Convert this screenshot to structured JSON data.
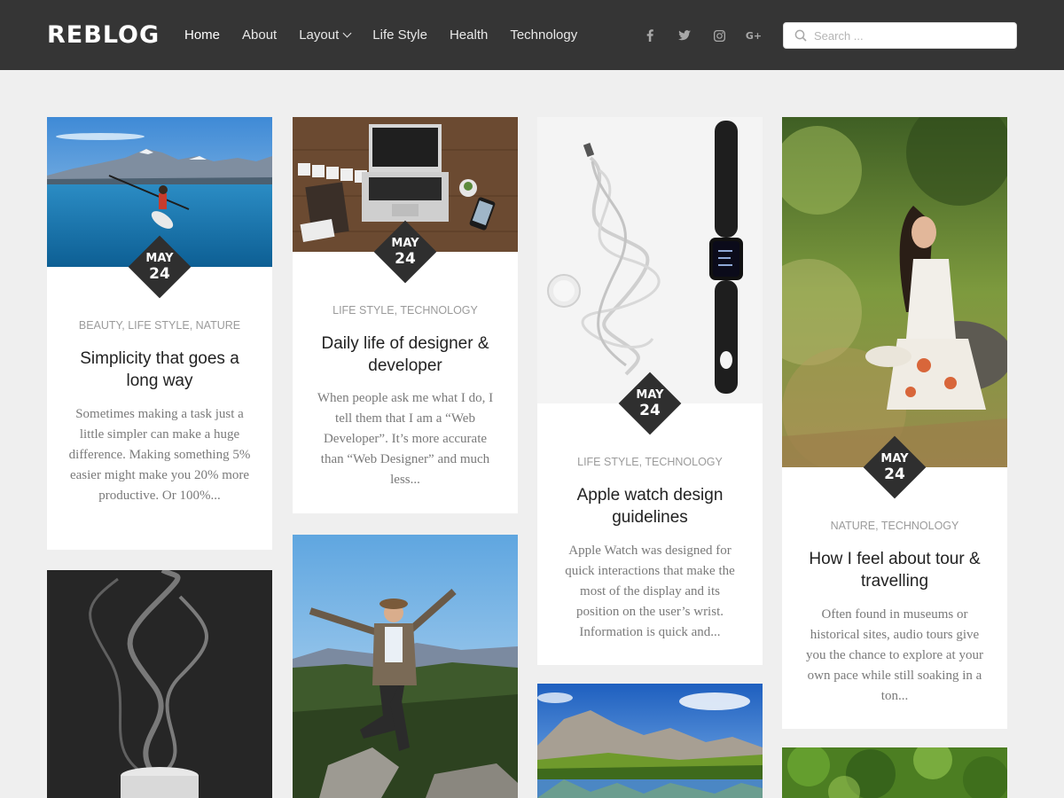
{
  "site": {
    "logo": "REBLOG"
  },
  "nav": {
    "items": [
      {
        "label": "Home"
      },
      {
        "label": "About"
      },
      {
        "label": "Layout"
      },
      {
        "label": "Life Style"
      },
      {
        "label": "Health"
      },
      {
        "label": "Technology"
      }
    ]
  },
  "social": {
    "icons": [
      "facebook-icon",
      "twitter-icon",
      "instagram-icon",
      "google-plus-icon"
    ],
    "gplus_label": "G+"
  },
  "search": {
    "placeholder": "Search ..."
  },
  "colors": {
    "header_bg": "#353535",
    "page_bg": "#efefef",
    "date_badge": "#2f2f2f",
    "category_text": "#9b9b9b"
  },
  "posts": [
    {
      "month": "MAY",
      "day": "24",
      "categories": [
        "BEAUTY",
        "LIFE STYLE",
        "NATURE"
      ],
      "sep": ", ",
      "title": "Simplicity that goes a long way",
      "excerpt": "Sometimes making a task just a little simpler can make a huge difference. Making something 5% easier might make you 20% more productive. Or 100%..."
    },
    {
      "month": "MAY",
      "day": "24",
      "categories": [
        "LIFE STYLE",
        "TECHNOLOGY"
      ],
      "title": "Daily life of designer & developer",
      "excerpt": "When people ask me what I do, I tell them that I am a “Web Developer”. It’s more accurate than “Web Designer” and much less..."
    },
    {
      "month": "MAY",
      "day": "24",
      "categories": [
        "LIFE STYLE",
        "TECHNOLOGY"
      ],
      "title": "Apple watch design guidelines",
      "excerpt": "Apple Watch was designed for quick interactions that make the most of the display and its position on the user’s wrist. Information is quick and..."
    },
    {
      "month": "MAY",
      "day": "24",
      "categories": [
        "NATURE",
        "TECHNOLOGY"
      ],
      "title": "How I feel about tour & travelling",
      "excerpt": "Often found in museums or historical sites, audio tours give you the chance to explore at your own pace while still soaking in a ton..."
    }
  ]
}
